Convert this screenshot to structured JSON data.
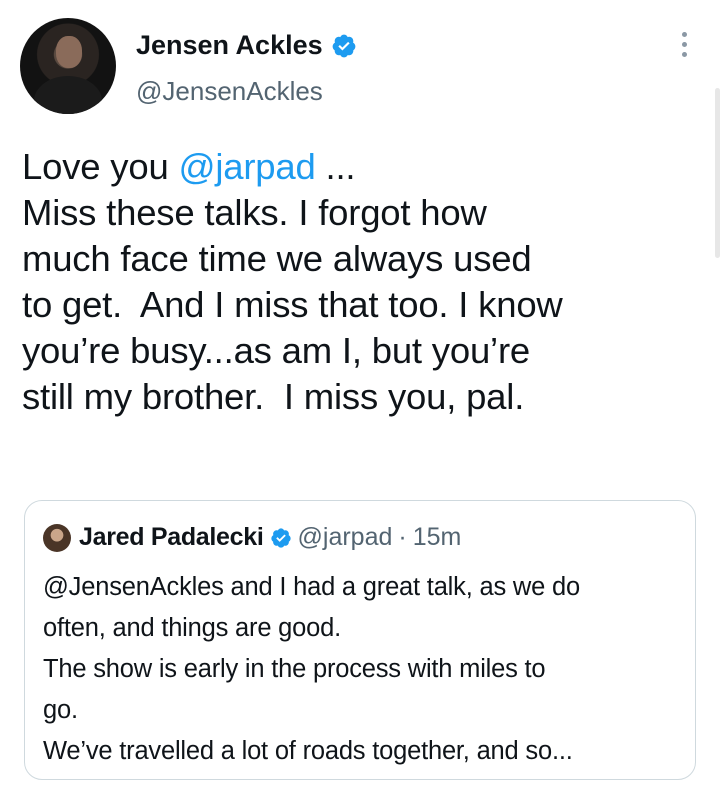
{
  "author": {
    "name": "Jensen Ackles",
    "handle": "@JensenAckles"
  },
  "tweet": {
    "lines": [
      {
        "prefix": "Love you ",
        "mention": "@jarpad",
        "suffix": " ..."
      },
      {
        "text": "Miss these talks. I forgot how"
      },
      {
        "text": "much face time we always used"
      },
      {
        "text": "to get.  And I miss that too. I know"
      },
      {
        "text": "you’re busy...as am I, but you’re"
      },
      {
        "text": "still my brother.  I miss you, pal."
      }
    ]
  },
  "quoted": {
    "name": "Jared Padalecki",
    "handle": "@jarpad",
    "separator": "·",
    "time": "15m",
    "lines": [
      "@JensenAckles and I had a great talk, as we do",
      "often, and things are good.",
      "The show is early in the process with miles to",
      "go.",
      "We’ve travelled a lot of roads together, and so..."
    ]
  },
  "colors": {
    "accent": "#1d9bf0",
    "text": "#0f1419",
    "secondary": "#536471",
    "border": "#cfd9de"
  },
  "icons": {
    "verified": "verified-badge-icon",
    "more": "more-options-icon"
  }
}
